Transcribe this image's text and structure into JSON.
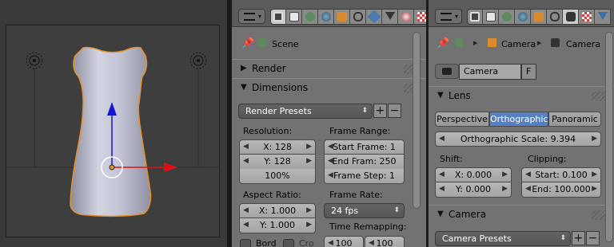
{
  "panel_a": {
    "context_label": "Scene",
    "sections": {
      "render": "Render",
      "dimensions": "Dimensions"
    },
    "render_presets": "Render Presets",
    "add_symbol": "+",
    "remove_symbol": "−",
    "resolution": {
      "label": "Resolution:",
      "x": "X: 128",
      "y": "Y: 128",
      "percent": "100%"
    },
    "frame_range": {
      "label": "Frame Range:",
      "start": "Start Frame: 1",
      "end": "End Fram: 250",
      "step": "Frame Step: 1"
    },
    "aspect_ratio": {
      "label": "Aspect Ratio:",
      "x": "X: 1.000",
      "y": "Y: 1.000"
    },
    "frame_rate": {
      "label": "Frame Rate:",
      "value": "24 fps"
    },
    "time_remapping": {
      "label": "Time Remapping:",
      "old": "100",
      "new": "100"
    },
    "border_label": "Bord",
    "crop_label": "Cro"
  },
  "panel_b": {
    "breadcrumb": [
      "Camera",
      "Camera"
    ],
    "datablock": {
      "name": "Camera",
      "fake_user": "F"
    },
    "sections": {
      "lens": "Lens",
      "camera": "Camera"
    },
    "lens_types": [
      "Perspective",
      "Orthographic",
      "Panoramic"
    ],
    "active_lens_type": "Orthographic",
    "ortho_scale": "Orthographic Scale: 9.394",
    "shift": {
      "label": "Shift:",
      "x": "X: 0.000",
      "y": "Y: 0.000"
    },
    "clipping": {
      "label": "Clipping:",
      "start": "Start: 0.100",
      "end": "End: 100.000"
    },
    "camera_presets": "Camera Presets",
    "add_symbol": "+",
    "remove_symbol": "−"
  },
  "colors": {
    "selection_outline": "#e8902a",
    "active_button": "#5680c2",
    "axis_x": "#e01010",
    "axis_z": "#1515d8"
  },
  "icons": [
    "pin-icon",
    "scene-icon",
    "camera-object-icon",
    "camera-data-icon",
    "editor-type-icon"
  ]
}
